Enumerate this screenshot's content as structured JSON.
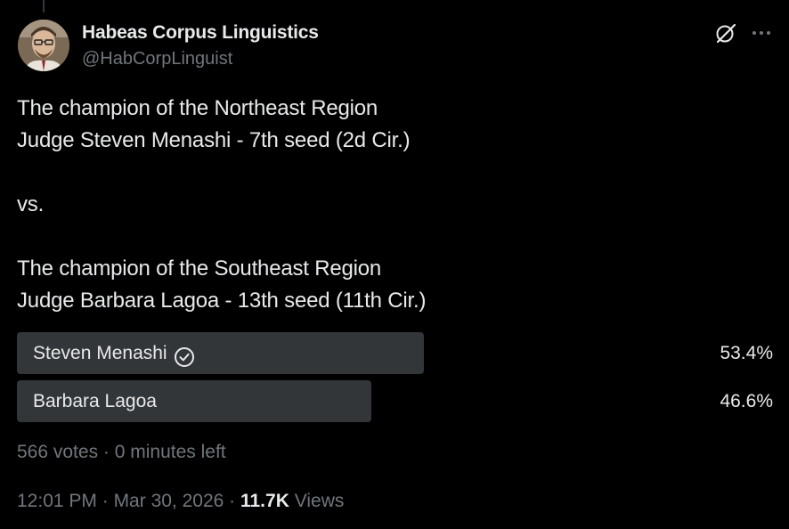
{
  "author": {
    "display_name": "Habeas Corpus Linguistics",
    "handle": "@HabCorpLinguist"
  },
  "tweet": {
    "text": "The champion of the Northeast Region\nJudge Steven Menashi - 7th seed (2d Cir.)\n\nvs.\n\nThe champion of the Southeast Region\nJudge Barbara Lagoa - 13th seed (11th Cir.)"
  },
  "poll": {
    "options": [
      {
        "label": "Steven Menashi",
        "percent": "53.4%",
        "fraction": 0.534,
        "selected": true
      },
      {
        "label": "Barbara Lagoa",
        "percent": "46.6%",
        "fraction": 0.466,
        "selected": false
      }
    ],
    "votes": "566 votes",
    "time_left": "0 minutes left",
    "separator": " · "
  },
  "meta": {
    "time": "12:01 PM",
    "date": "Mar 30, 2026",
    "views_count": "11.7K",
    "views_label": "Views",
    "separator": " · "
  },
  "icons": {
    "grok": "grok-icon",
    "more": "more-icon",
    "selected_check": "check-circle-icon"
  },
  "colors": {
    "background": "#000000",
    "text_primary": "#e7e9ea",
    "text_secondary": "#71767b",
    "poll_bar": "#333639"
  }
}
